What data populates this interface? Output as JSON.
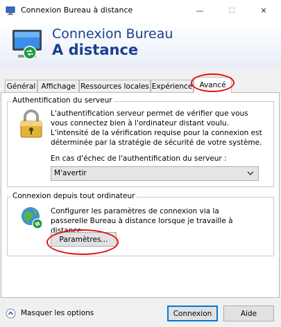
{
  "window": {
    "title": "Connexion Bureau à distance",
    "minimize_glyph": "—",
    "maximize_glyph": "☐",
    "close_glyph": "✕"
  },
  "header": {
    "title_line1": "Connexion Bureau",
    "title_line2": "A distance",
    "icon": "remote-desktop-icon"
  },
  "tabs": [
    {
      "label": "Général"
    },
    {
      "label": "Affichage"
    },
    {
      "label": "Ressources locales"
    },
    {
      "label": "Expérience"
    },
    {
      "label": "Avancé",
      "active": true
    }
  ],
  "auth_group": {
    "legend": "Authentification du serveur",
    "icon": "padlock-icon",
    "description": "L'authentification serveur permet de vérifier que vous vous connectez bien à l'ordinateur distant voulu. L'intensité de la vérification requise pour la connexion est déterminée par la stratégie de sécurité de votre système.",
    "select_label": "En cas d'échec de l'authentification du serveur :",
    "select_value": "M'avertir"
  },
  "connect_group": {
    "legend": "Connexion depuis tout ordinateur",
    "icon": "globe-network-icon",
    "description": "Configurer les paramètres de connexion via la passerelle Bureau à distance lorsque je travaille à distance.",
    "settings_button": "Paramètres..."
  },
  "footer": {
    "hide_options": "Masquer les options",
    "connect_button": "Connexion",
    "help_button": "Aide"
  },
  "colors": {
    "accent": "#0078d7",
    "header_text": "#1b3f8f",
    "annotation_red": "#e01010"
  }
}
